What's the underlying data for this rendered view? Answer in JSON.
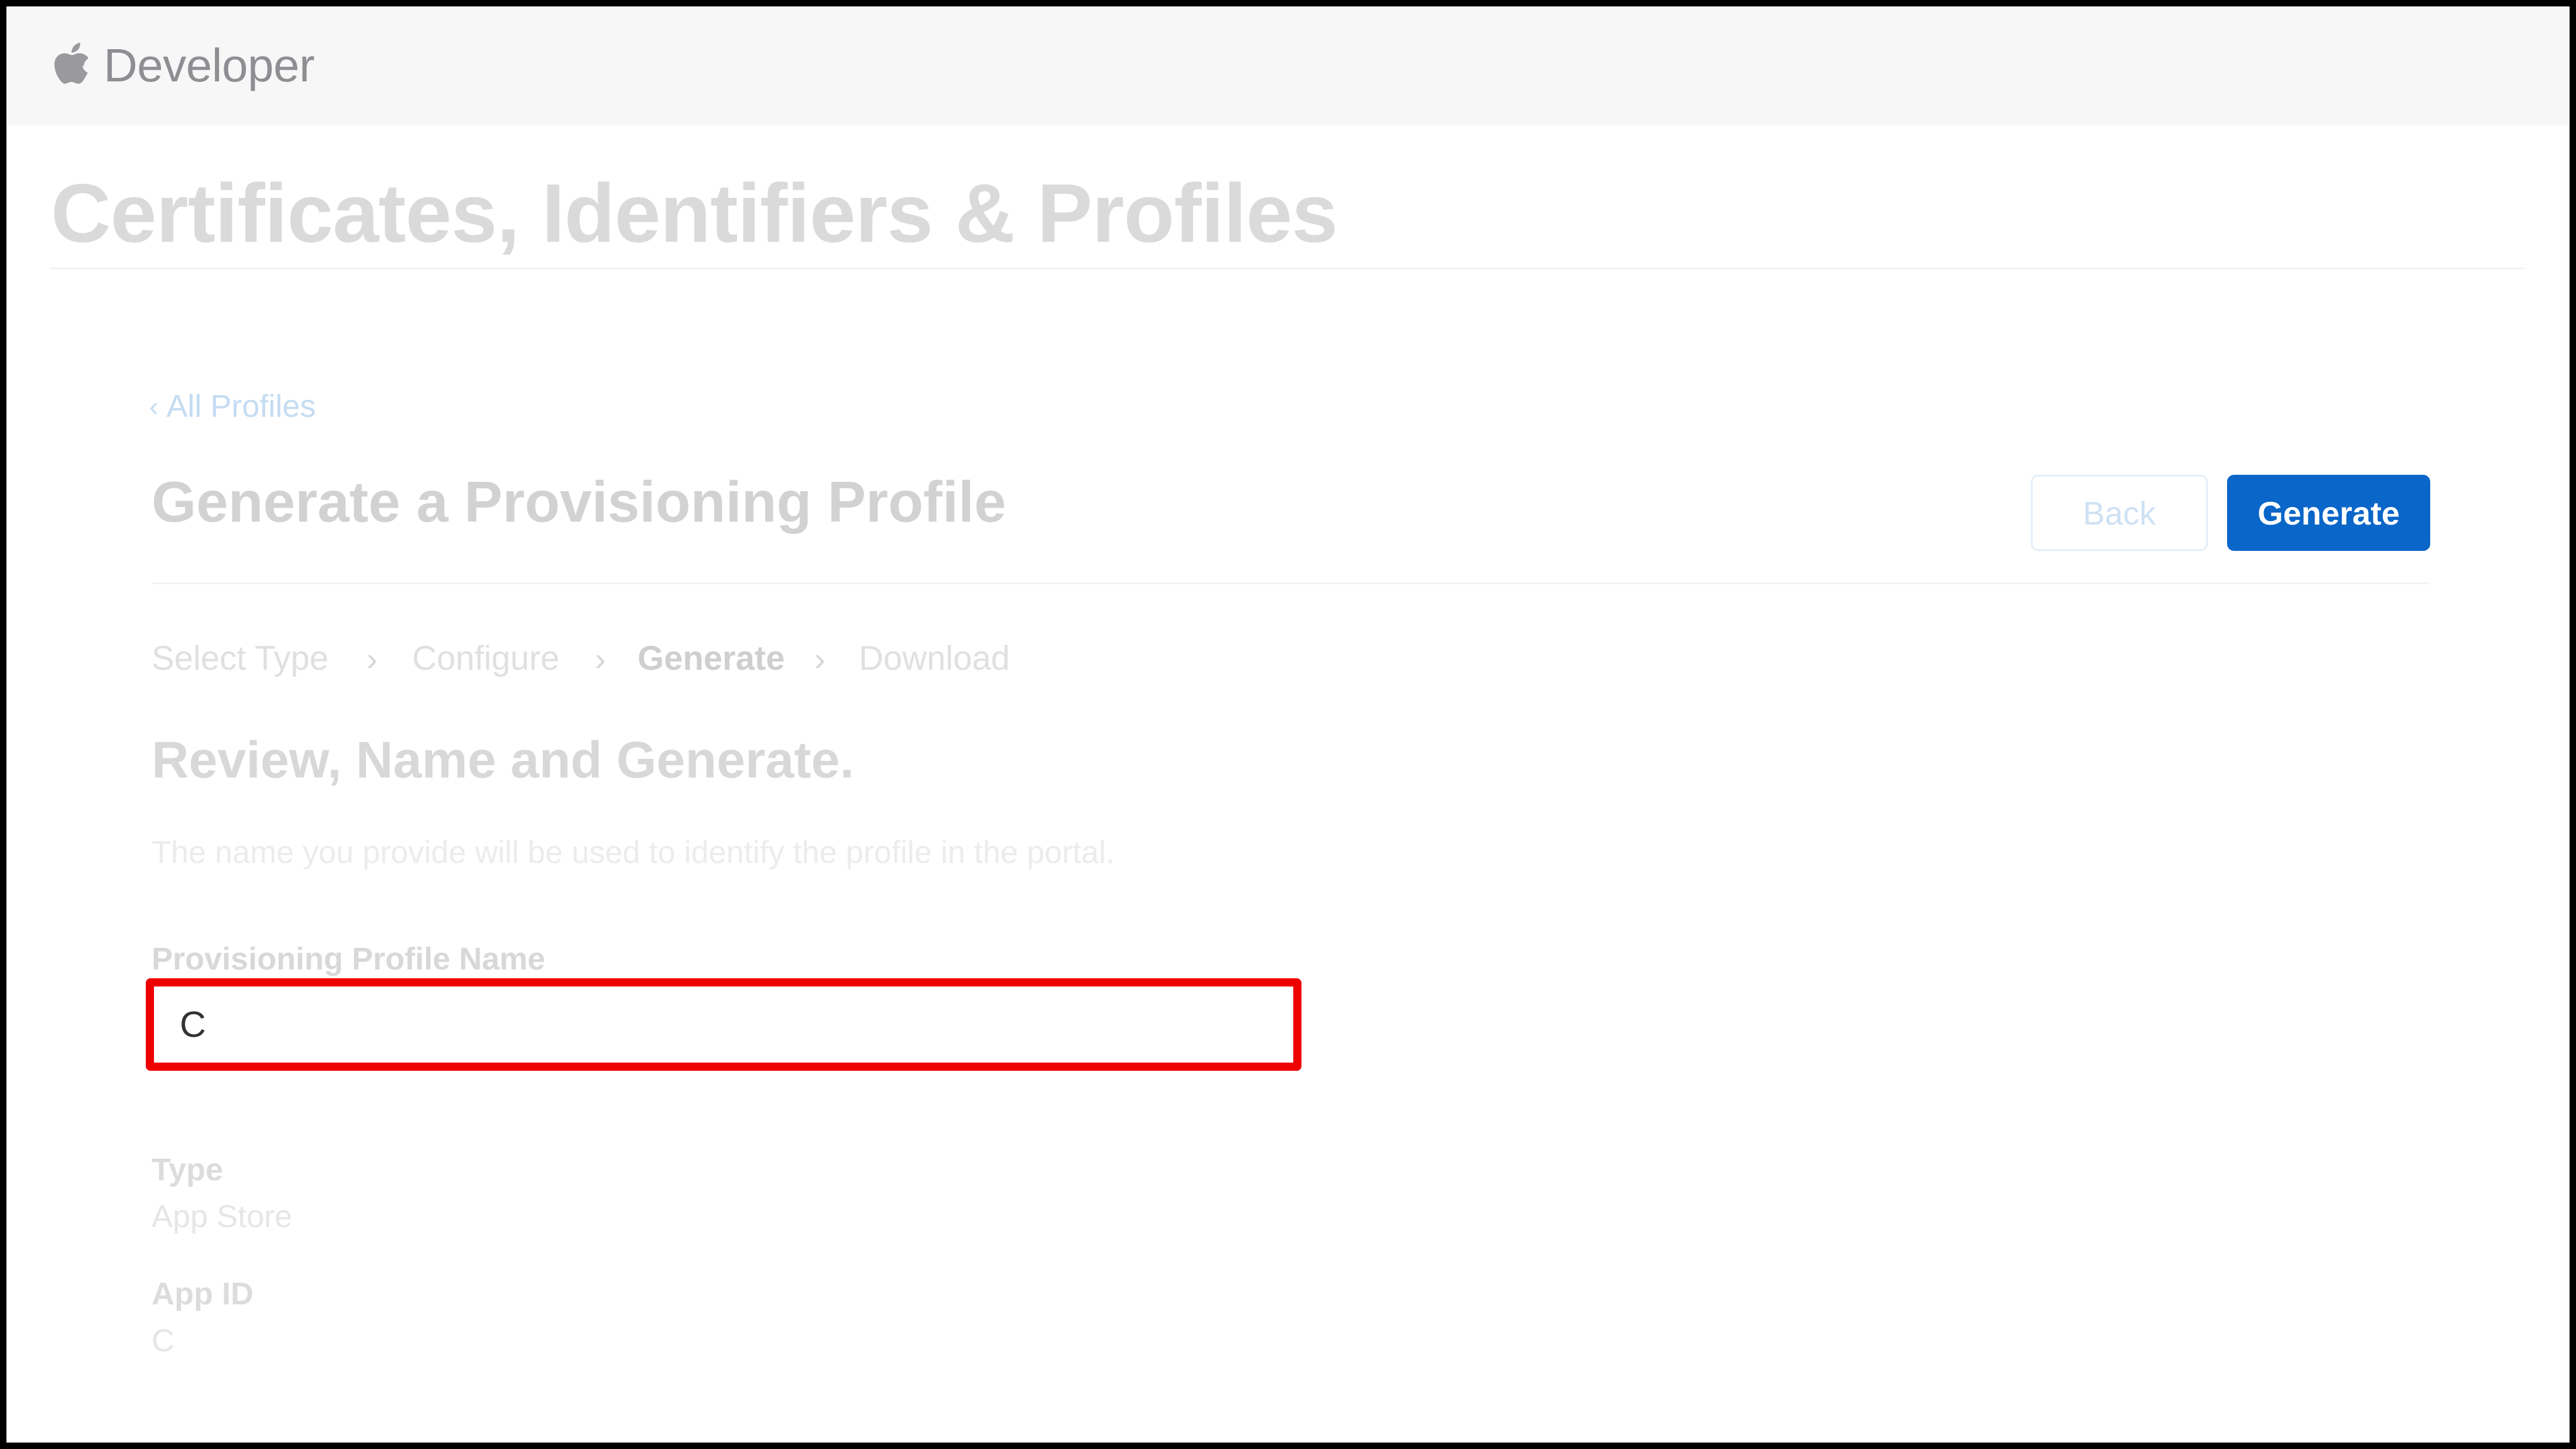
{
  "header": {
    "brand": "Developer",
    "logo_icon": "apple-logo-icon"
  },
  "page": {
    "title": "Certificates, Identifiers & Profiles"
  },
  "nav": {
    "back_link": "All Profiles",
    "back_icon": "chevron-left-icon"
  },
  "section": {
    "title": "Generate a Provisioning Profile",
    "back_button": "Back",
    "generate_button": "Generate"
  },
  "steps": [
    {
      "label": "Select Type",
      "active": false
    },
    {
      "label": "Configure",
      "active": false
    },
    {
      "label": "Generate",
      "active": true
    },
    {
      "label": "Download",
      "active": false
    }
  ],
  "form": {
    "heading": "Review, Name and Generate.",
    "description": "The name you provide will be used to identify the profile in the portal.",
    "name_label": "Provisioning Profile Name",
    "name_value": "C"
  },
  "details": {
    "type_label": "Type",
    "type_value": "App Store",
    "appid_label": "App ID",
    "appid_value": "C"
  },
  "colors": {
    "accent": "#0a66c8",
    "highlight": "#ee0000"
  }
}
